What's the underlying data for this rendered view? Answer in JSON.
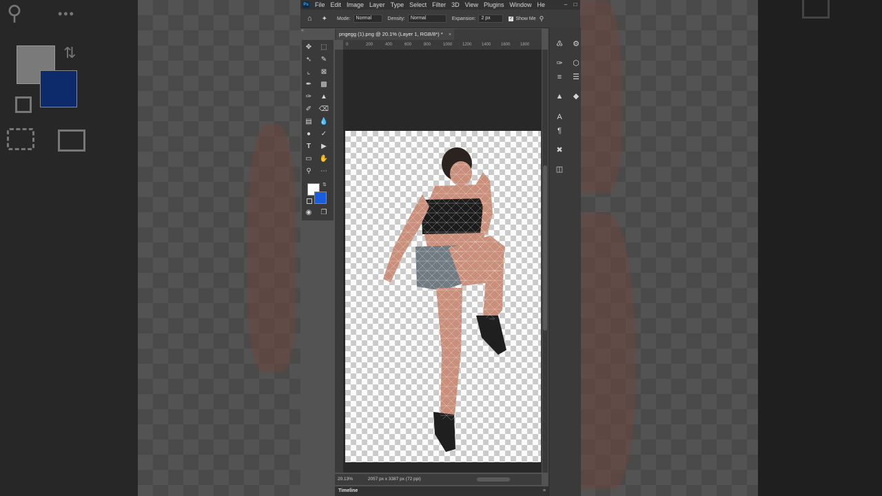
{
  "app": {
    "name": "Photoshop",
    "logo": "Ps"
  },
  "menu": {
    "items": [
      "File",
      "Edit",
      "Image",
      "Layer",
      "Type",
      "Select",
      "Filter",
      "3D",
      "View",
      "Plugins",
      "Window",
      "He"
    ]
  },
  "options": {
    "mode_label": "Mode:",
    "mode_value": "Normal",
    "density_label": "Density:",
    "density_value": "Normal",
    "expansion_label": "Expansion:",
    "expansion_value": "2 px",
    "show_mesh_label": "Show Me"
  },
  "document": {
    "tab_title": "pngegg (1).png @ 20.1% (Layer 1, RGB/8*) *",
    "close": "×"
  },
  "ruler": {
    "top_ticks": [
      "0",
      "200",
      "400",
      "600",
      "800",
      "1000",
      "1200",
      "1400",
      "1600",
      "1800"
    ]
  },
  "status": {
    "zoom": "20.13%",
    "info": "2057 px x 3387 px (72 ppi)"
  },
  "timeline": {
    "label": "Timeline"
  },
  "colors": {
    "foreground": "#ffffff",
    "background": "#1a5ee0",
    "accent": "#31a8ff"
  }
}
